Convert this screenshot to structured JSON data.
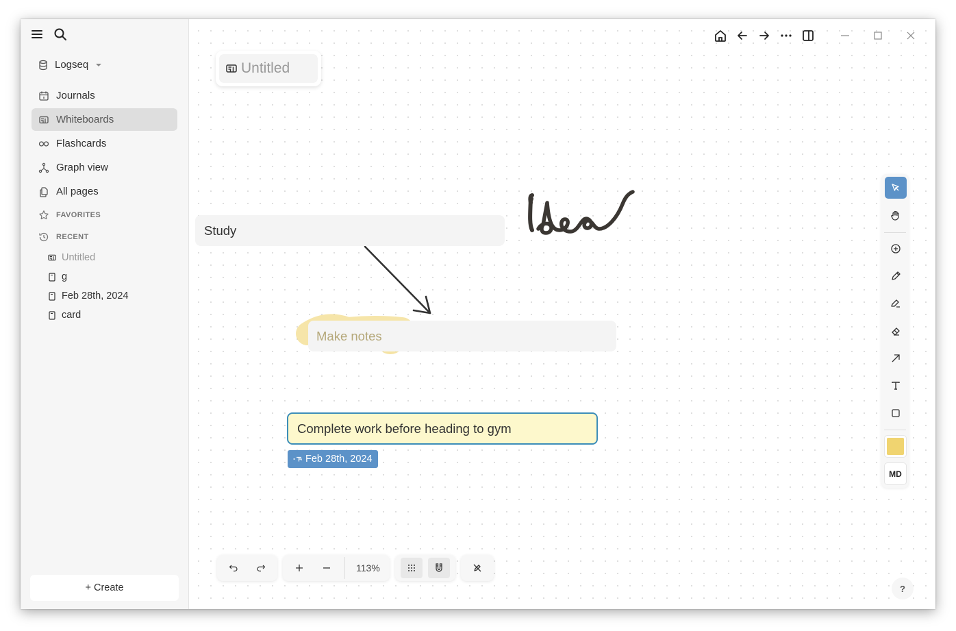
{
  "sidebar": {
    "graph_name": "Logseq",
    "nav": [
      {
        "label": "Journals",
        "icon": "calendar-icon"
      },
      {
        "label": "Whiteboards",
        "icon": "whiteboard-icon",
        "active": true
      },
      {
        "label": "Flashcards",
        "icon": "infinity-icon"
      },
      {
        "label": "Graph view",
        "icon": "graph-icon"
      },
      {
        "label": "All pages",
        "icon": "pages-icon"
      }
    ],
    "favorites_label": "FAVORITES",
    "recent_label": "RECENT",
    "recent": [
      {
        "label": "Untitled",
        "icon": "whiteboard-icon"
      },
      {
        "label": "g",
        "icon": "page-icon"
      },
      {
        "label": "Feb 28th, 2024",
        "icon": "page-icon"
      },
      {
        "label": "card",
        "icon": "page-icon"
      }
    ],
    "create_label": "+ Create"
  },
  "whiteboard": {
    "title": "Untitled",
    "shapes": {
      "study": "Study",
      "notes": "Make notes",
      "task": "Complete work before heading to gym",
      "handwriting": "idea"
    },
    "date_tag": "Feb 28th, 2024"
  },
  "toolbar": {
    "color_swatch": "#f0d470",
    "md_label": "MD",
    "active_tool": "select"
  },
  "bottom": {
    "zoom_level": "113%"
  },
  "help_label": "?",
  "colors": {
    "accent": "#5c92c8",
    "task_fill": "#fdf8cc",
    "task_border": "#3d8eb9",
    "highlight": "#f0d470"
  }
}
